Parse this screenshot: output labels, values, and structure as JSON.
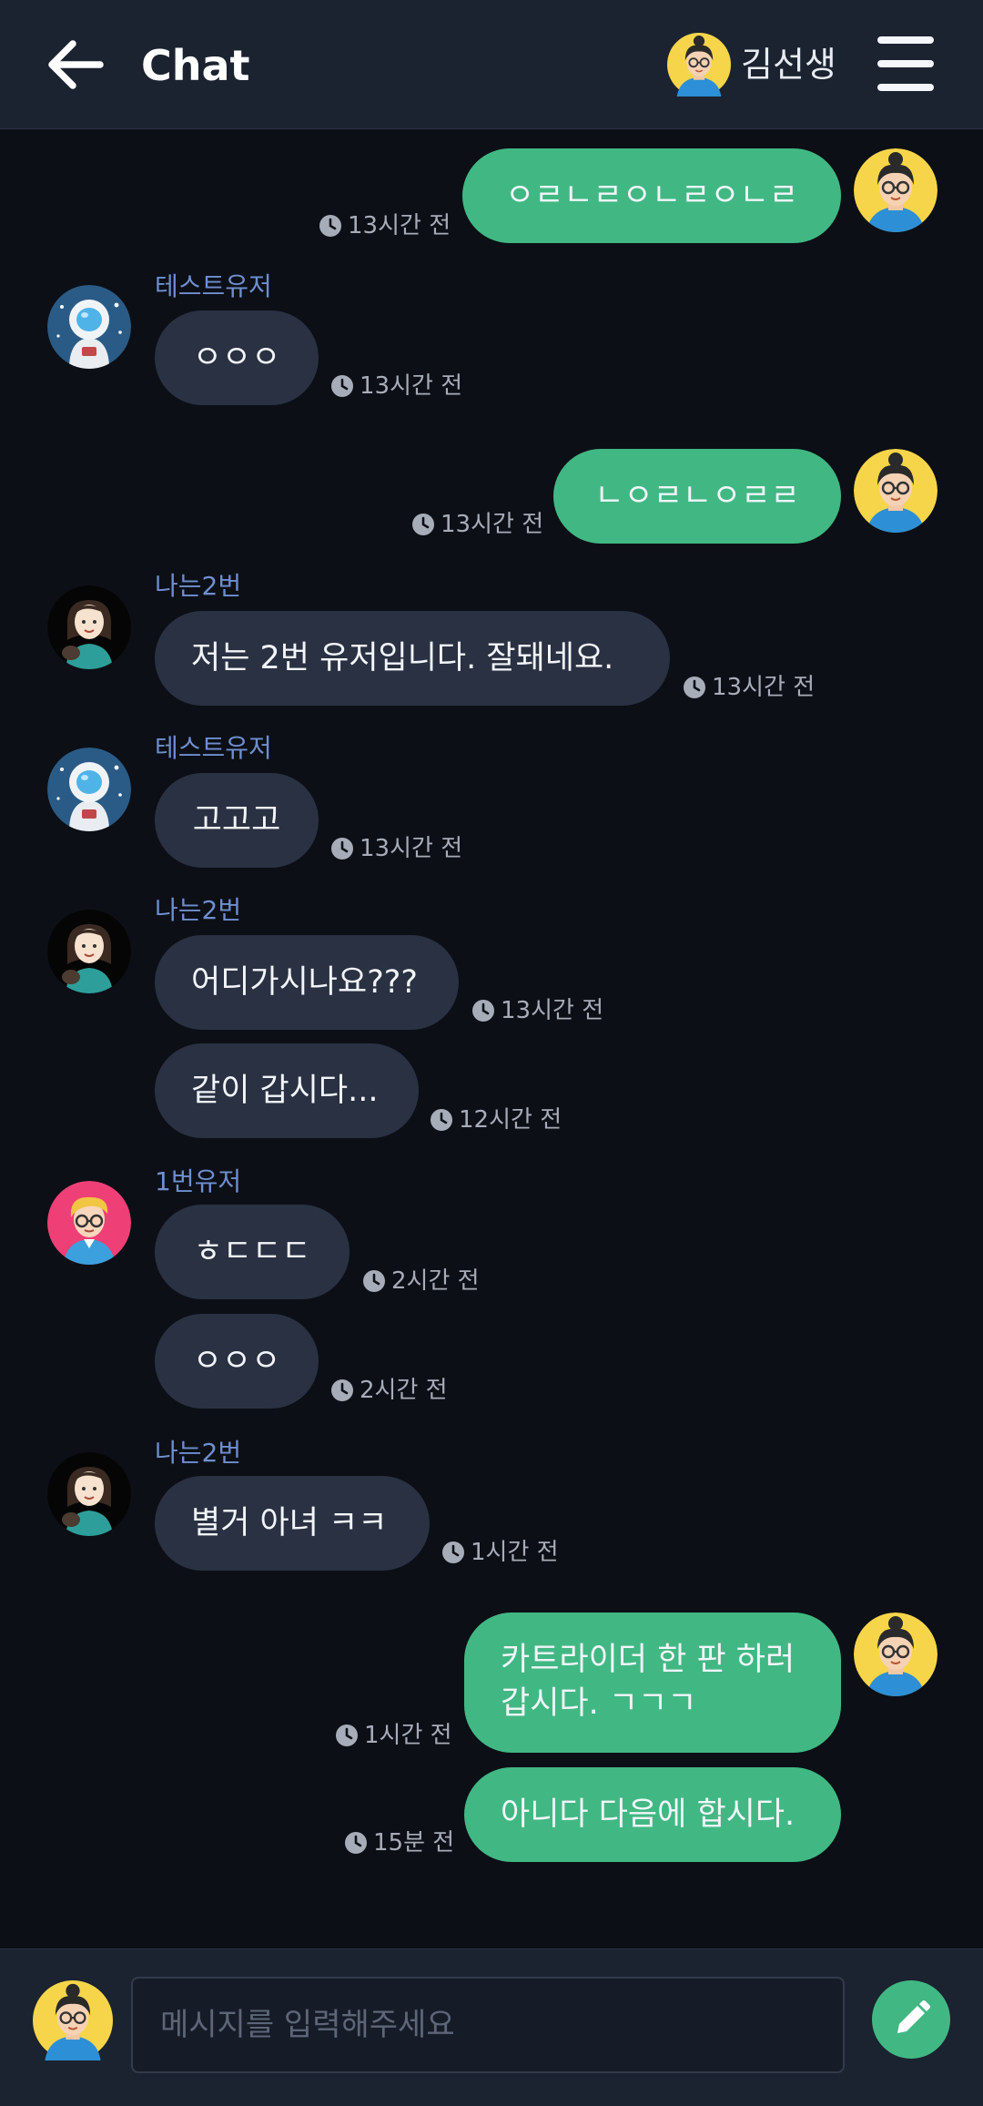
{
  "header": {
    "title": "Chat",
    "user_name": "김선생",
    "back_icon": "arrow-left-icon",
    "menu_icon": "hamburger-menu-icon"
  },
  "colors": {
    "header_bg": "#1b2230",
    "chat_bg": "#0c0f16",
    "incoming_bubble": "#293142",
    "outgoing_bubble": "#41b883",
    "sender_name": "#6f8fd0"
  },
  "messages": [
    {
      "text": "ㅇㄹㄴㄹㅇㄴㄹㅇㄴㄹ",
      "time": "13시간 전"
    },
    {
      "sender": "테스트유저",
      "text": "ㅇㅇㅇ",
      "time": "13시간 전"
    },
    {
      "text": "ㄴㅇㄹㄴㅇㄹㄹ",
      "time": "13시간 전"
    },
    {
      "sender": "나는2번",
      "text": "저는 2번 유저입니다. 잘돼네요.",
      "time": "13시간 전"
    },
    {
      "sender": "테스트유저",
      "text": "고고고",
      "time": "13시간 전"
    },
    {
      "sender": "나는2번",
      "text": "어디가시나요???",
      "time": "13시간 전"
    },
    {
      "text": "같이 갑시다...",
      "time": "12시간 전"
    },
    {
      "sender": "1번유저",
      "text": "ㅎㄷㄷㄷ",
      "time": "2시간 전"
    },
    {
      "text": "ㅇㅇㅇ",
      "time": "2시간 전"
    },
    {
      "sender": "나는2번",
      "text": "별거 아녀 ㅋㅋ",
      "time": "1시간 전"
    },
    {
      "text": "카트라이더 한 판 하러 갑시다. ㄱㄱㄱ",
      "time": "1시간 전"
    },
    {
      "text": "아니다 다음에 합시다.",
      "time": "15분 전"
    }
  ],
  "composer": {
    "placeholder": "메시지를 입력해주세요",
    "value": "",
    "send_icon": "pencil-icon"
  }
}
